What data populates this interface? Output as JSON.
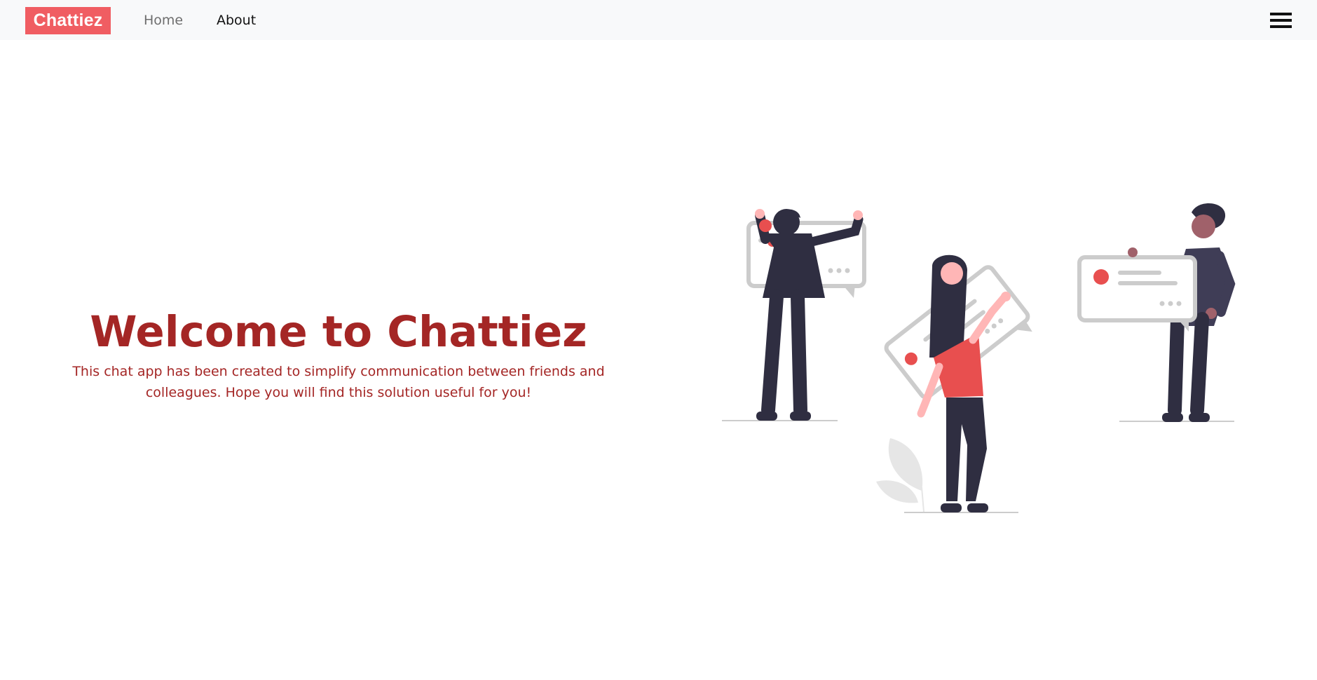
{
  "navbar": {
    "brand": "Chattiez",
    "links": [
      {
        "label": "Home"
      },
      {
        "label": "About"
      }
    ],
    "menu_icon": "hamburger-menu-icon"
  },
  "hero": {
    "title": "Welcome to Chattiez",
    "description": "This chat app has been created to simplify communication between friends and colleagues. Hope you will find this solution useful for you!"
  },
  "illustration": {
    "subject": "people-holding-chat-bubbles-illustration"
  },
  "colors": {
    "brand": "#f05d62",
    "heading": "#a42625",
    "navbar_bg": "#f8f9fa",
    "figure_dark": "#2f2e41",
    "bubble_gray": "#cccccc",
    "accent_red": "#e84f4f",
    "skin_light": "#ffb6b6"
  }
}
